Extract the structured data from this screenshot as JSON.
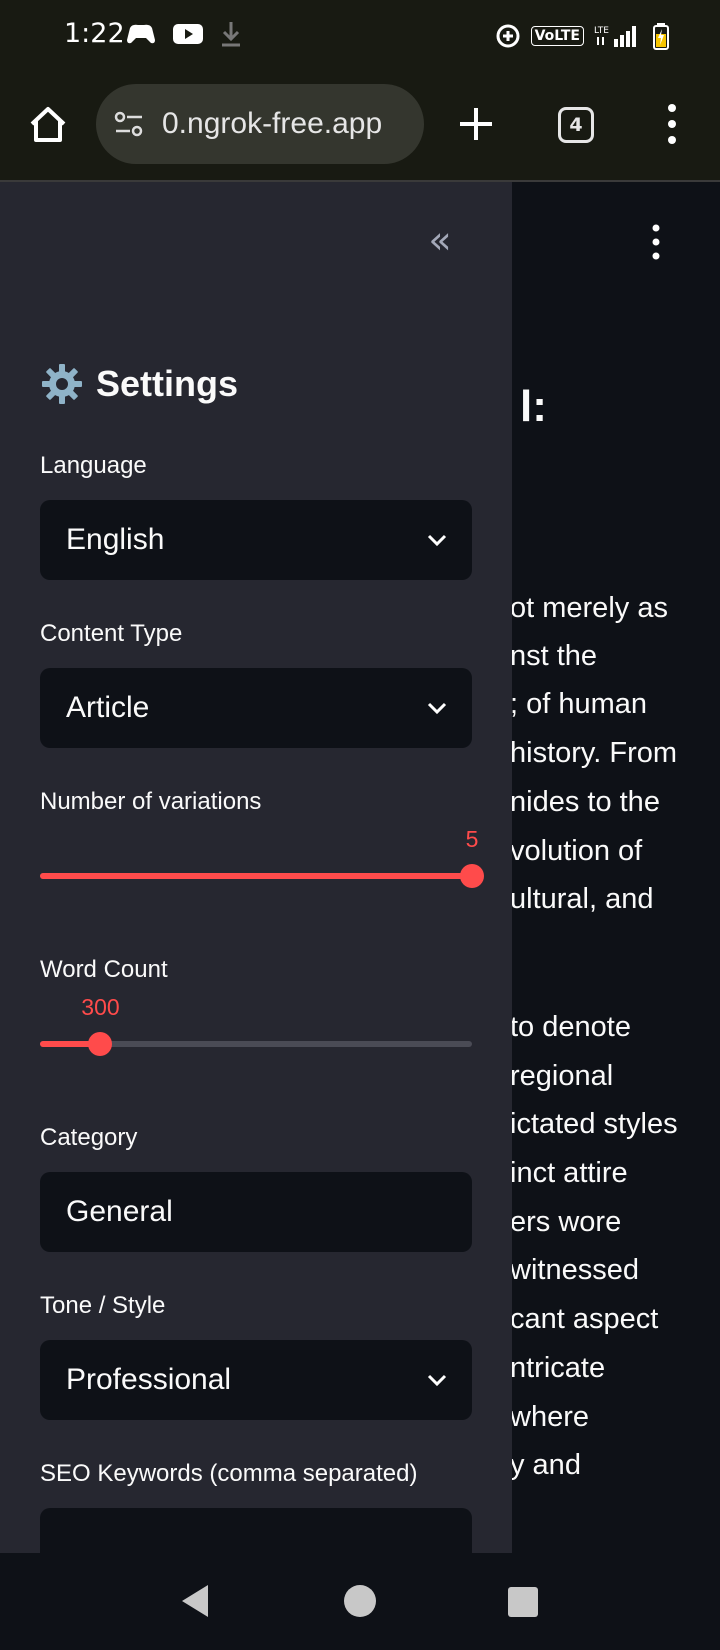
{
  "status_bar": {
    "time": "1:22",
    "volte": "VoLTE",
    "lte": "LTE"
  },
  "browser": {
    "url": "0.ngrok-free.app",
    "tab_count": "4"
  },
  "sidebar": {
    "title": "Settings",
    "language": {
      "label": "Language",
      "value": "English"
    },
    "content_type": {
      "label": "Content Type",
      "value": "Article"
    },
    "variations": {
      "label": "Number of variations",
      "value": "5",
      "fraction": 1.0
    },
    "word_count": {
      "label": "Word Count",
      "value": "300",
      "fraction": 0.14
    },
    "category": {
      "label": "Category",
      "value": "General"
    },
    "tone": {
      "label": "Tone / Style",
      "value": "Professional"
    },
    "seo": {
      "label": "SEO Keywords (comma separated)",
      "value": ""
    }
  },
  "main": {
    "heading": "l:",
    "lines": [
      "ot merely as",
      "nst the",
      "; of human",
      "history. From",
      "nides to the",
      "volution of",
      "ultural, and",
      "to denote",
      "regional",
      "ictated styles",
      "inct attire",
      "ers wore",
      "witnessed",
      "cant aspect",
      "ntricate",
      "where",
      "y and"
    ]
  },
  "colors": {
    "accent": "#ff4b4b",
    "sidebar_bg": "#262730",
    "main_bg": "#0e1117",
    "browser_bg": "#181a12"
  }
}
